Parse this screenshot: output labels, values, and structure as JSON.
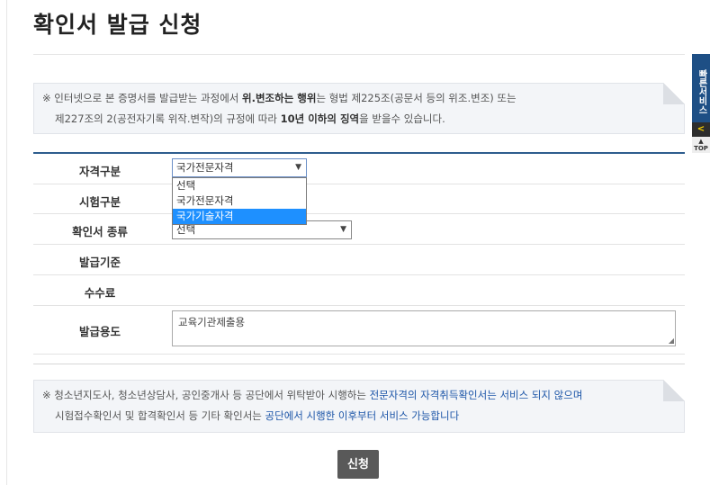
{
  "page": {
    "title": "확인서 발급 신청"
  },
  "notice_top": {
    "mark": "※",
    "line1_a": "인터넷으로 본 증명서를 발급받는 과정에서 ",
    "line1_b": "위.변조하는 행위",
    "line1_c": "는 형법 제225조(공문서 등의 위조.변조) 또는",
    "line2_a": "제227조의 2(공전자기록 위작.변작)의 규정에 따라 ",
    "line2_b": "10년 이하의 징역",
    "line2_c": "을 받을수 있습니다."
  },
  "form": {
    "qualification": {
      "label": "자격구분",
      "value": "국가전문자격",
      "options": [
        "선택",
        "국가전문자격",
        "국가기술자격"
      ],
      "highlighted": "국가기술자격"
    },
    "exam_type": {
      "label": "시험구분"
    },
    "cert_type": {
      "label": "확인서 종류",
      "value": "선택"
    },
    "issue_basis": {
      "label": "발급기준"
    },
    "fee": {
      "label": "수수료"
    },
    "purpose": {
      "label": "발급용도",
      "value": "교육기관제출용"
    }
  },
  "notice_bottom": {
    "mark": "※",
    "line1_a": "청소년지도사, 청소년상담사, 공인중개사 등 공단에서 위탁받아 시행하는 ",
    "line1_b": "전문자격의 자격취득확인서는 서비스 되지 않으며",
    "line2_a": "시험접수확인서 및 합격확인서 등 기타 확인서는 ",
    "line2_b": "공단에서 시행한 이후부터 서비스 가능합니다"
  },
  "submit_label": "신청",
  "quick_service": {
    "label": "빠른서비스",
    "arrow": "<",
    "top": "TOP"
  },
  "colors": {
    "accent": "#2e5d8e",
    "highlight": "#1e90ff",
    "link": "#1d56a8",
    "button": "#595959"
  }
}
